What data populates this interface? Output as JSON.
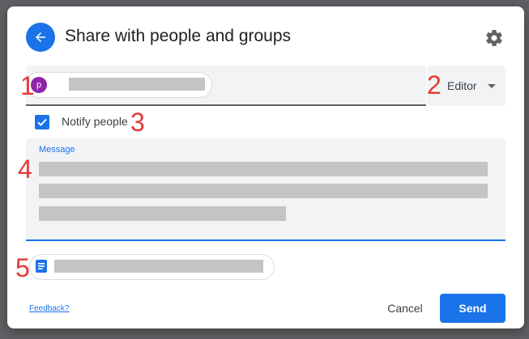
{
  "dialog": {
    "title": "Share with people and groups"
  },
  "recipient": {
    "avatar_initial": "p"
  },
  "role": {
    "selected": "Editor"
  },
  "notify": {
    "label": "Notify people",
    "checked": true
  },
  "message": {
    "label": "Message"
  },
  "footer": {
    "feedback_label": "Feedback?",
    "cancel_label": "Cancel",
    "send_label": "Send"
  },
  "annotations": [
    "1",
    "2",
    "3",
    "4",
    "5"
  ],
  "colors": {
    "primary": "#1a73e8",
    "avatar": "#8e24aa",
    "annotation": "#e53935"
  },
  "icons": {
    "back": "arrow-left-icon",
    "settings": "gear-icon",
    "dropdown": "caret-down-icon",
    "check": "checkmark-icon",
    "document": "docs-icon"
  }
}
